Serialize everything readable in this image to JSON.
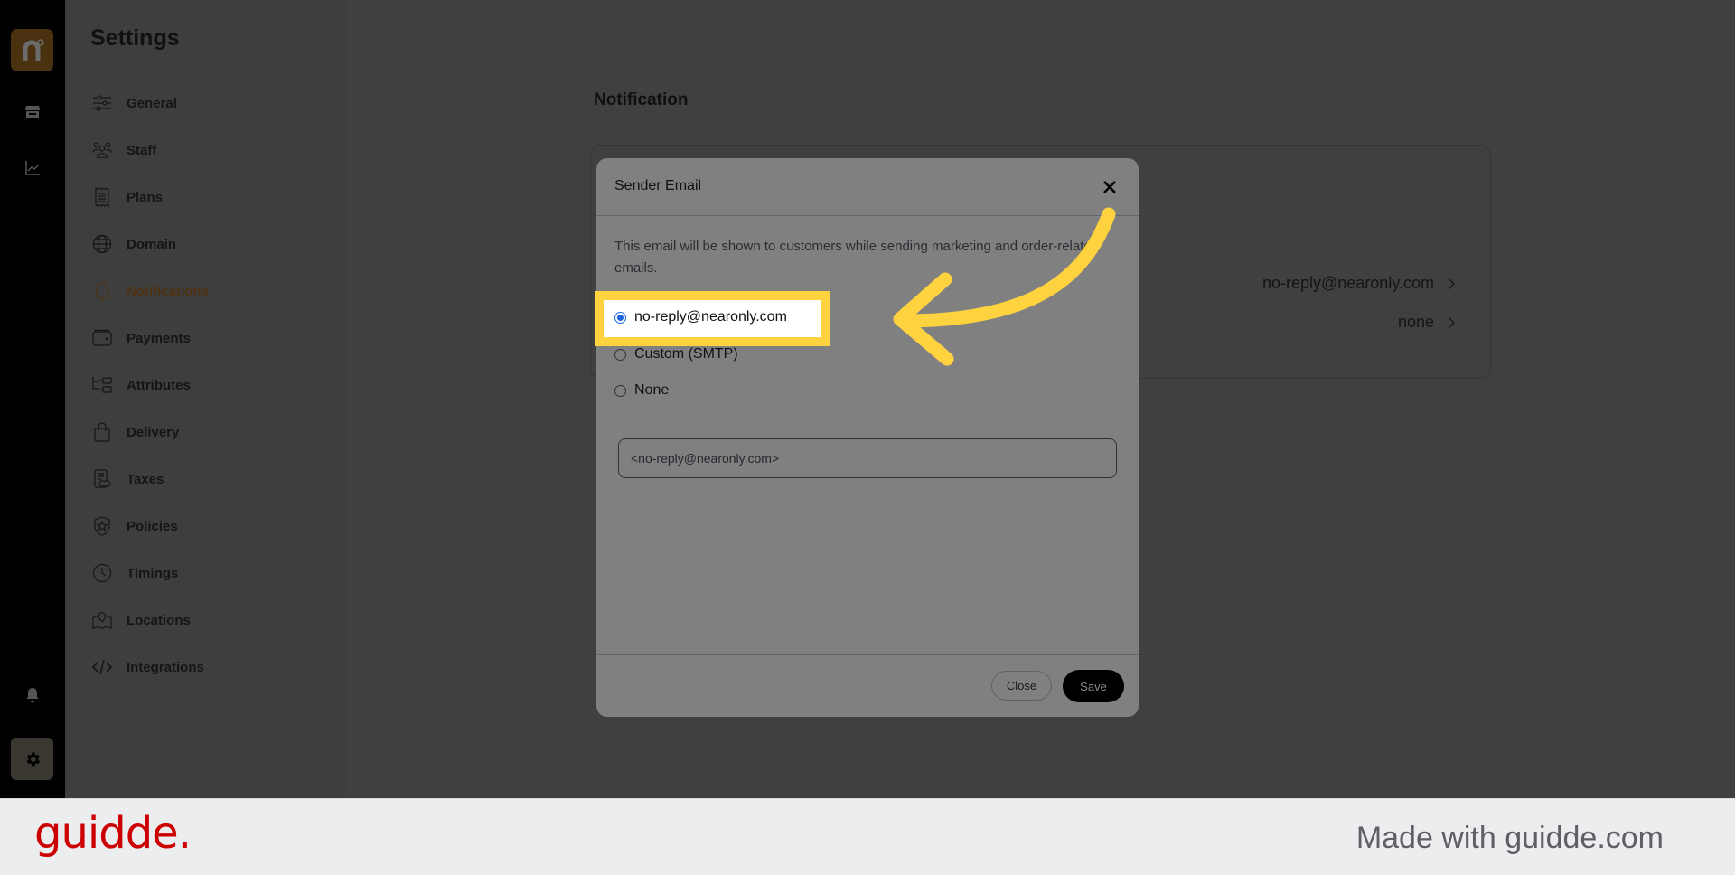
{
  "rail": {
    "logo_letter": "n",
    "icons": [
      "store-icon",
      "chart-icon"
    ],
    "bottom_icons": [
      "bell-icon",
      "gear-icon"
    ]
  },
  "sidebar": {
    "title": "Settings",
    "items": [
      {
        "label": "General",
        "icon": "sliders-icon",
        "active": false
      },
      {
        "label": "Staff",
        "icon": "users-icon",
        "active": false
      },
      {
        "label": "Plans",
        "icon": "receipt-icon",
        "active": false
      },
      {
        "label": "Domain",
        "icon": "globe-icon",
        "active": false
      },
      {
        "label": "Notifications",
        "icon": "bell-icon",
        "active": true
      },
      {
        "label": "Payments",
        "icon": "wallet-icon",
        "active": false
      },
      {
        "label": "Attributes",
        "icon": "hierarchy-icon",
        "active": false
      },
      {
        "label": "Delivery",
        "icon": "bag-icon",
        "active": false
      },
      {
        "label": "Taxes",
        "icon": "tax-receipt-icon",
        "active": false
      },
      {
        "label": "Policies",
        "icon": "shield-star-icon",
        "active": false
      },
      {
        "label": "Timings",
        "icon": "clock-icon",
        "active": false
      },
      {
        "label": "Locations",
        "icon": "map-pin-icon",
        "active": false
      },
      {
        "label": "Integrations",
        "icon": "code-icon",
        "active": false
      }
    ]
  },
  "main": {
    "heading": "Notification",
    "card_rows": [
      {
        "value": "no-reply@nearonly.com"
      },
      {
        "value": "none"
      }
    ]
  },
  "modal": {
    "title": "Sender Email",
    "description": "This email will be shown to customers while sending marketing and order-related emails.",
    "options": [
      {
        "label": "no-reply@nearonly.com",
        "checked": true
      },
      {
        "label": "Custom (SMTP)",
        "checked": false
      },
      {
        "label": "None",
        "checked": false
      }
    ],
    "input_value": "<no-reply@nearonly.com>",
    "close_label": "Close",
    "save_label": "Save"
  },
  "annotation": {
    "highlight_color": "#FFD23F"
  },
  "footer": {
    "brand": "guidde.",
    "tagline": "Made with guidde.com"
  }
}
